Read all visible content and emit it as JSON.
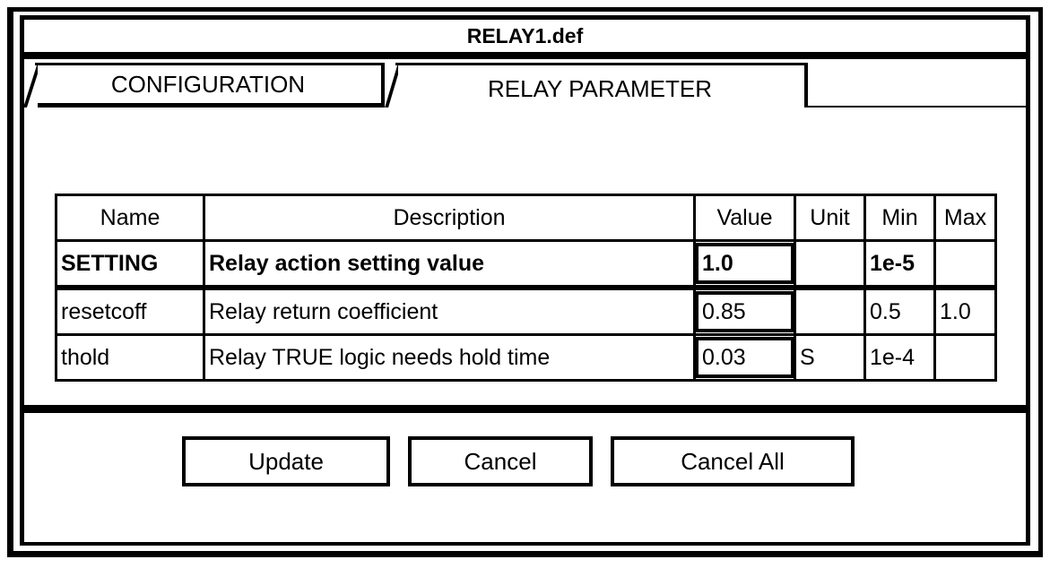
{
  "window": {
    "title": "RELAY1.def"
  },
  "tabs": [
    {
      "label": "CONFIGURATION",
      "active": false
    },
    {
      "label": "RELAY PARAMETER",
      "active": true
    }
  ],
  "table": {
    "columns": [
      "Name",
      "Description",
      "Value",
      "Unit",
      "Min",
      "Max"
    ],
    "rows": [
      {
        "name": "SETTING",
        "description": "Relay action setting value",
        "value": "1.0",
        "unit": "",
        "min": "1e-5",
        "max": "",
        "selected": true
      },
      {
        "name": "resetcoff",
        "description": "Relay return coefficient",
        "value": "0.85",
        "unit": "",
        "min": "0.5",
        "max": "1.0",
        "selected": false
      },
      {
        "name": "thold",
        "description": "Relay TRUE logic needs hold time",
        "value": "0.03",
        "unit": "S",
        "min": "1e-4",
        "max": "",
        "selected": false
      }
    ]
  },
  "buttons": {
    "update": "Update",
    "cancel": "Cancel",
    "cancel_all": "Cancel All"
  },
  "colors": {
    "foreground": "#000000",
    "background": "#ffffff"
  }
}
